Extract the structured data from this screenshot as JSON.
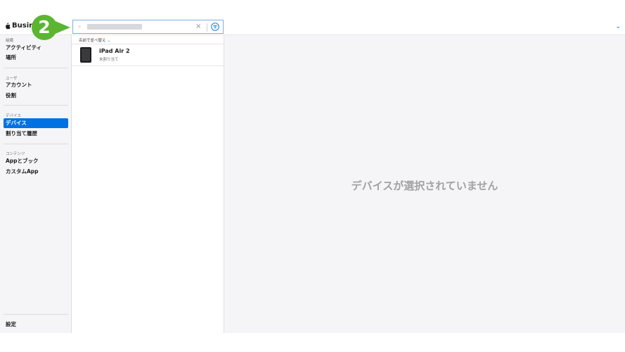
{
  "topbar": {
    "logo_text": "Busine"
  },
  "sidebar": {
    "sections": [
      {
        "label": "組織",
        "items": [
          {
            "label": "アクティビティ"
          },
          {
            "label": "場所"
          }
        ]
      },
      {
        "label": "ユーザ",
        "items": [
          {
            "label": "アカウント"
          },
          {
            "label": "役割"
          }
        ]
      },
      {
        "label": "デバイス",
        "items": [
          {
            "label": "デバイス",
            "active": true
          },
          {
            "label": "割り当て履歴"
          }
        ]
      },
      {
        "label": "コンテンツ",
        "items": [
          {
            "label": "Appとブック"
          },
          {
            "label": "カスタムApp"
          }
        ]
      }
    ],
    "footer_item": "設定"
  },
  "search": {
    "value": "xxxxxxxxxxxx",
    "clear": "×"
  },
  "list": {
    "sort_label": "名前で並べ替え",
    "sort_chevron": "⌄",
    "devices": [
      {
        "name": "iPad Air 2",
        "status": "未割り当て"
      }
    ]
  },
  "detail": {
    "empty_message": "デバイスが選択されていません"
  },
  "annotation": {
    "number": "2",
    "color": "#5cb531"
  },
  "colors": {
    "accent": "#0071e3"
  }
}
